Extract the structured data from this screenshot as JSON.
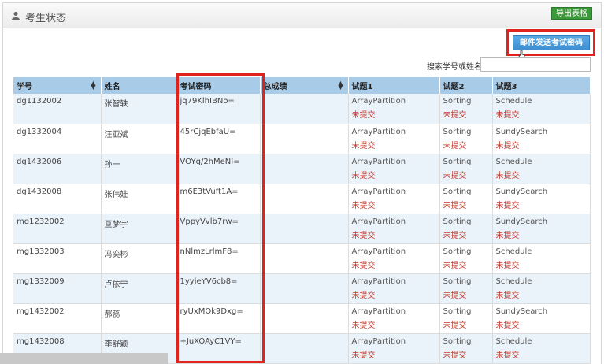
{
  "header": {
    "title": "考生状态",
    "export_label": "导出表格"
  },
  "toolbar": {
    "send_label": "邮件发送考试密码"
  },
  "search": {
    "label": "搜索学号或姓名",
    "value": ""
  },
  "table": {
    "columns": [
      "学号",
      "姓名",
      "考试密码",
      "总成绩",
      "试题1",
      "试题2",
      "试题3"
    ],
    "rows": [
      {
        "id": "dg1132002",
        "name": "张智轶",
        "password": "jq79KlhIBNo=",
        "total": "",
        "q1": "ArrayPartition",
        "q1_status": "未提交",
        "q2": "Sorting",
        "q2_status": "未提交",
        "q3": "Schedule",
        "q3_status": "未提交"
      },
      {
        "id": "dg1332004",
        "name": "汪亚斌",
        "password": "45rCjqEbfaU=",
        "total": "",
        "q1": "ArrayPartition",
        "q1_status": "未提交",
        "q2": "Sorting",
        "q2_status": "未提交",
        "q3": "SundySearch",
        "q3_status": "未提交"
      },
      {
        "id": "dg1432006",
        "name": "孙一",
        "password": "VOYg/2hMeNI=",
        "total": "",
        "q1": "ArrayPartition",
        "q1_status": "未提交",
        "q2": "Sorting",
        "q2_status": "未提交",
        "q3": "Schedule",
        "q3_status": "未提交"
      },
      {
        "id": "dg1432008",
        "name": "张伟娃",
        "password": "m6E3tVuft1A=",
        "total": "",
        "q1": "ArrayPartition",
        "q1_status": "未提交",
        "q2": "Sorting",
        "q2_status": "未提交",
        "q3": "SundySearch",
        "q3_status": "未提交"
      },
      {
        "id": "mg1232002",
        "name": "亘梦宇",
        "password": "VppyVvlb7rw=",
        "total": "",
        "q1": "ArrayPartition",
        "q1_status": "未提交",
        "q2": "Sorting",
        "q2_status": "未提交",
        "q3": "SundySearch",
        "q3_status": "未提交"
      },
      {
        "id": "mg1332003",
        "name": "冯奕彬",
        "password": "nNlmzLrlmF8=",
        "total": "",
        "q1": "ArrayPartition",
        "q1_status": "未提交",
        "q2": "Sorting",
        "q2_status": "未提交",
        "q3": "Schedule",
        "q3_status": "未提交"
      },
      {
        "id": "mg1332009",
        "name": "卢依宁",
        "password": "1yyieYV6cb8=",
        "total": "",
        "q1": "ArrayPartition",
        "q1_status": "未提交",
        "q2": "Sorting",
        "q2_status": "未提交",
        "q3": "Schedule",
        "q3_status": "未提交"
      },
      {
        "id": "mg1432002",
        "name": "郝蕊",
        "password": "ryUxMOk9Dxg=",
        "total": "",
        "q1": "ArrayPartition",
        "q1_status": "未提交",
        "q2": "Sorting",
        "q2_status": "未提交",
        "q3": "SundySearch",
        "q3_status": "未提交"
      },
      {
        "id": "mg1432008",
        "name": "李舒颖",
        "password": "+JuXOAyC1VY=",
        "total": "",
        "q1": "ArrayPartition",
        "q1_status": "未提交",
        "q2": "Sorting",
        "q2_status": "未提交",
        "q3": "Schedule",
        "q3_status": "未提交"
      }
    ]
  },
  "icons": {
    "header": "user-icon",
    "sort": "sort-icon",
    "cursor": "cursor-icon"
  },
  "colors": {
    "header_bg": "#a8cbe8",
    "status_red": "#c0392b",
    "export_green": "#3a9a3a",
    "send_blue": "#3d8fd1",
    "highlight_red": "#e0231c"
  }
}
